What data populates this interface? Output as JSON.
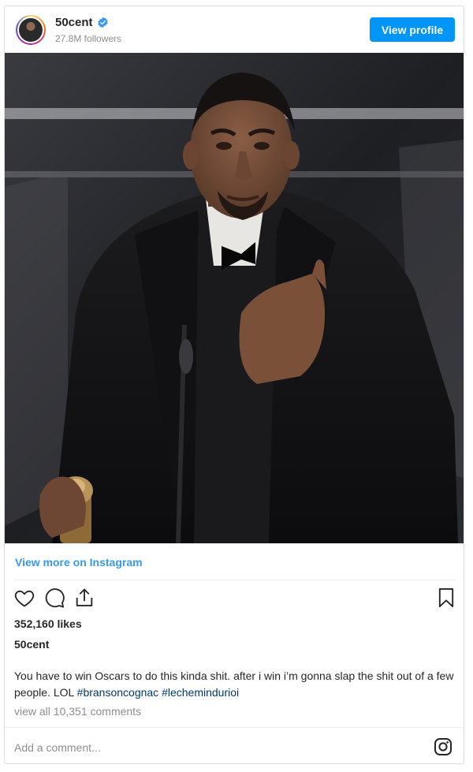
{
  "header": {
    "username": "50cent",
    "followers": "27.8M followers",
    "view_profile_label": "View profile"
  },
  "post": {
    "image_description_icon": "photo",
    "view_more_label": "View more on Instagram",
    "likes": "352,160 likes",
    "author": "50cent",
    "caption_text": "You have to win Oscars to do this kinda shit. after i win i’m gonna slap the shit out of a few people. LOL ",
    "hashtag_1": "#bransoncognac",
    "hashtag_2": "#lechemindurioi",
    "comments_link": "view all 10,351 comments",
    "add_comment_placeholder": "Add a comment..."
  },
  "icons": [
    "verified-badge-icon",
    "heart-icon",
    "comment-icon",
    "share-icon",
    "bookmark-icon",
    "instagram-icon"
  ],
  "colors": {
    "accent_blue": "#0095f6",
    "link_blue": "#3897f0",
    "hashtag_blue": "#00376b",
    "muted_gray": "#8e8e8e"
  }
}
